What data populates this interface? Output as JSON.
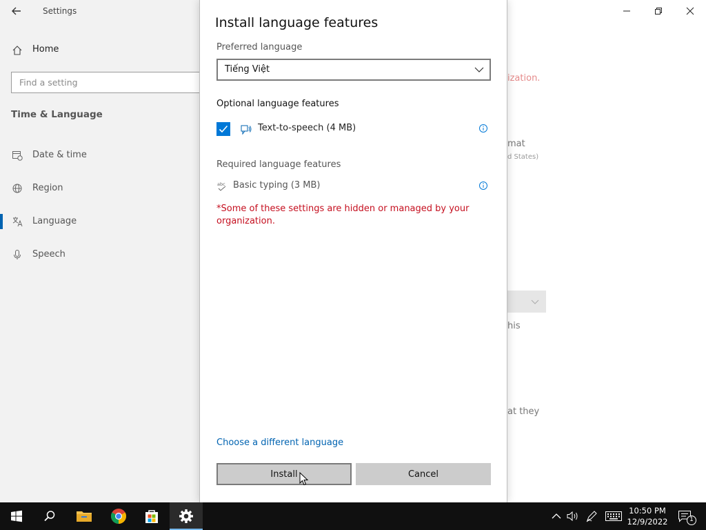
{
  "settings": {
    "app_title": "Settings",
    "home_label": "Home",
    "search_placeholder": "Find a setting",
    "section_title": "Time & Language",
    "nav_items": [
      {
        "label": "Date & time",
        "icon": "calendar-clock-icon"
      },
      {
        "label": "Region",
        "icon": "globe-icon"
      },
      {
        "label": "Language",
        "icon": "language-icon"
      },
      {
        "label": "Speech",
        "icon": "microphone-icon"
      }
    ],
    "active_nav": "Language",
    "background_fragments": [
      "ization.",
      "mat",
      "d States)",
      "his",
      "at they"
    ]
  },
  "dialog": {
    "title": "Install language features",
    "preferred_label": "Preferred language",
    "preferred_value": "Tiếng Việt",
    "optional_heading": "Optional language features",
    "optional_feature": {
      "label": "Text-to-speech (4 MB)",
      "checked": true
    },
    "required_heading": "Required language features",
    "required_feature": {
      "label": "Basic typing (3 MB)"
    },
    "warning": "*Some of these settings are hidden or managed by your organization.",
    "link": "Choose a different language",
    "install_label": "Install",
    "cancel_label": "Cancel"
  },
  "taskbar": {
    "apps": [
      "start-icon",
      "search-icon",
      "file-explorer-icon",
      "chrome-icon",
      "store-icon",
      "settings-icon"
    ],
    "active_app": "settings-icon",
    "time": "10:50 PM",
    "date": "12/9/2022",
    "notification_count": "1"
  },
  "colors": {
    "accent": "#0078d7",
    "link": "#0063b1",
    "warning": "#c50f1f",
    "taskbar": "#101010",
    "sidebar": "#f2f2f2",
    "button": "#cccccc"
  }
}
